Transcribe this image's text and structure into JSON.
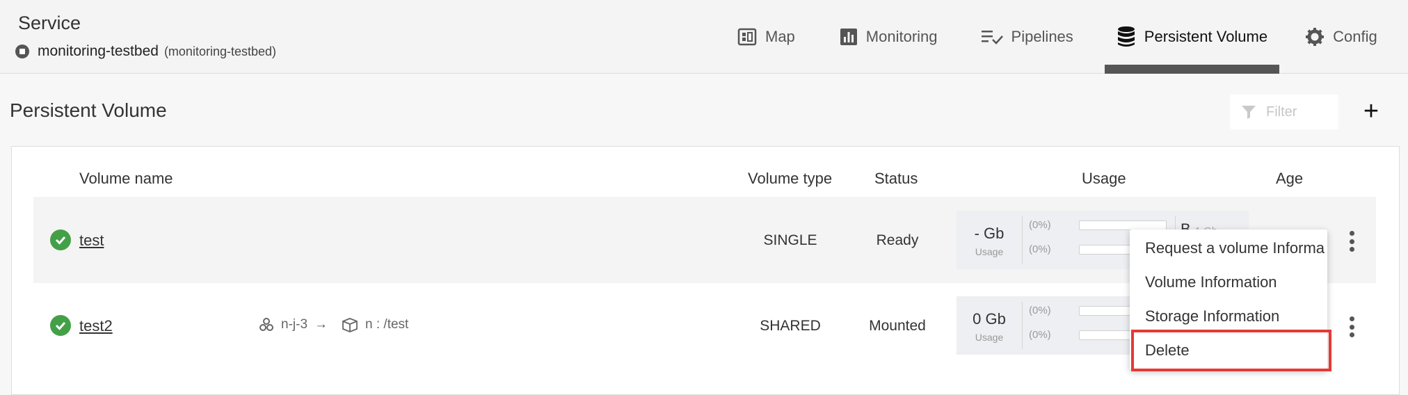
{
  "header": {
    "service_label": "Service",
    "namespace": "monitoring-testbed",
    "namespace_sub": "(monitoring-testbed)",
    "tabs": [
      {
        "label": "Map",
        "icon": "map-icon"
      },
      {
        "label": "Monitoring",
        "icon": "chart-icon"
      },
      {
        "label": "Pipelines",
        "icon": "pipeline-icon"
      },
      {
        "label": "Persistent Volume",
        "icon": "database-icon",
        "active": true
      },
      {
        "label": "Config",
        "icon": "gear-icon"
      }
    ]
  },
  "section": {
    "title": "Persistent Volume",
    "filter_placeholder": "Filter",
    "add_label": "+"
  },
  "table": {
    "columns": [
      "Volume name",
      "Volume type",
      "Status",
      "Usage",
      "Age"
    ],
    "rows": [
      {
        "name": "test",
        "type": "SINGLE",
        "status": "Ready",
        "usage_value": "- Gb",
        "usage_label": "Usage",
        "pct1": "(0%)",
        "pct2": "(0%)",
        "capacity_letter": "B",
        "capacity": "1 Gb"
      },
      {
        "name": "test2",
        "mount_node": "n-j-3",
        "mount_path": "n : /test",
        "type": "SHARED",
        "status": "Mounted",
        "usage_value": "0 Gb",
        "usage_label": "Usage",
        "pct1": "(0%)",
        "pct2": "(0%)"
      }
    ]
  },
  "menu": {
    "items": [
      "Request a volume Informa",
      "Volume Information",
      "Storage Information",
      "Delete"
    ]
  },
  "colors": {
    "status_ok": "#43a047",
    "highlight": "#e53935"
  }
}
